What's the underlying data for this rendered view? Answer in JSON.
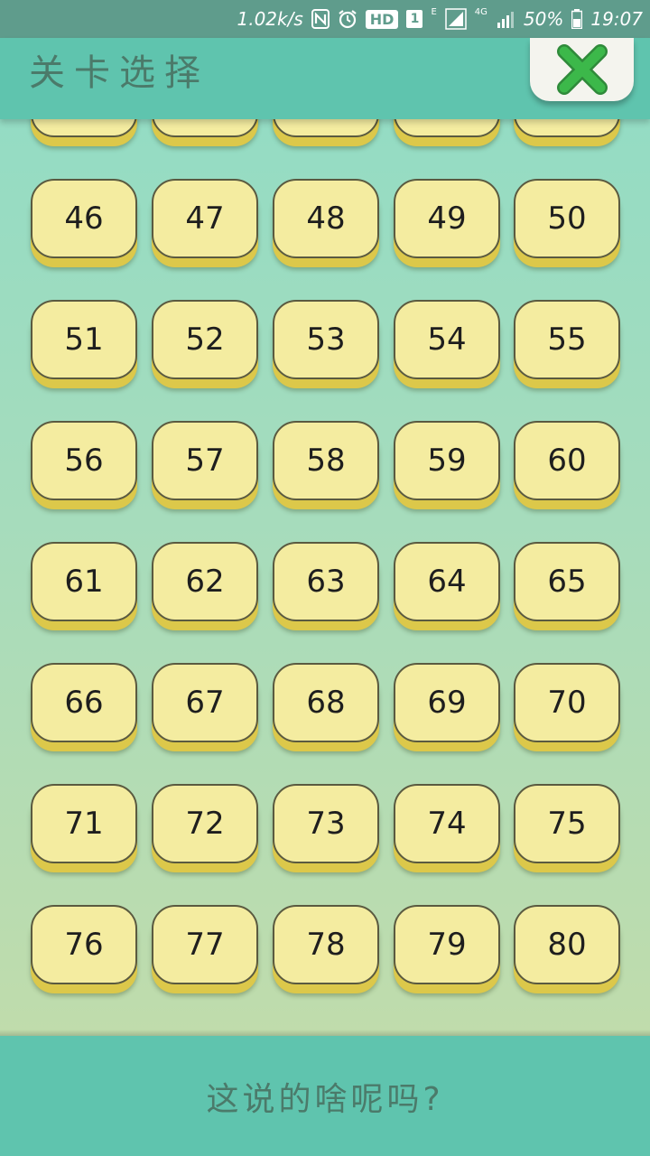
{
  "status_bar": {
    "net_speed": "1.02k/s",
    "hd_badge": "HD",
    "sim_slot": "1",
    "edge_label": "E",
    "lte_label": "4G",
    "battery_percent": "50%",
    "time": "19:07",
    "icons": [
      "nfc-icon",
      "alarm-icon",
      "signal-icon",
      "battery-icon"
    ]
  },
  "header": {
    "title": "关卡选择",
    "close_icon": "close-x-icon",
    "close_color": "#3cb84a"
  },
  "levels": [
    "",
    "",
    "",
    "",
    "",
    "46",
    "47",
    "48",
    "49",
    "50",
    "51",
    "52",
    "53",
    "54",
    "55",
    "56",
    "57",
    "58",
    "59",
    "60",
    "61",
    "62",
    "63",
    "64",
    "65",
    "66",
    "67",
    "68",
    "69",
    "70",
    "71",
    "72",
    "73",
    "74",
    "75",
    "76",
    "77",
    "78",
    "79",
    "80"
  ],
  "footer": {
    "text": "这说的啥呢吗?"
  },
  "colors": {
    "header_bg": "#5fc4ae",
    "button_face": "#f4eca0",
    "button_base": "#dcc84a"
  }
}
